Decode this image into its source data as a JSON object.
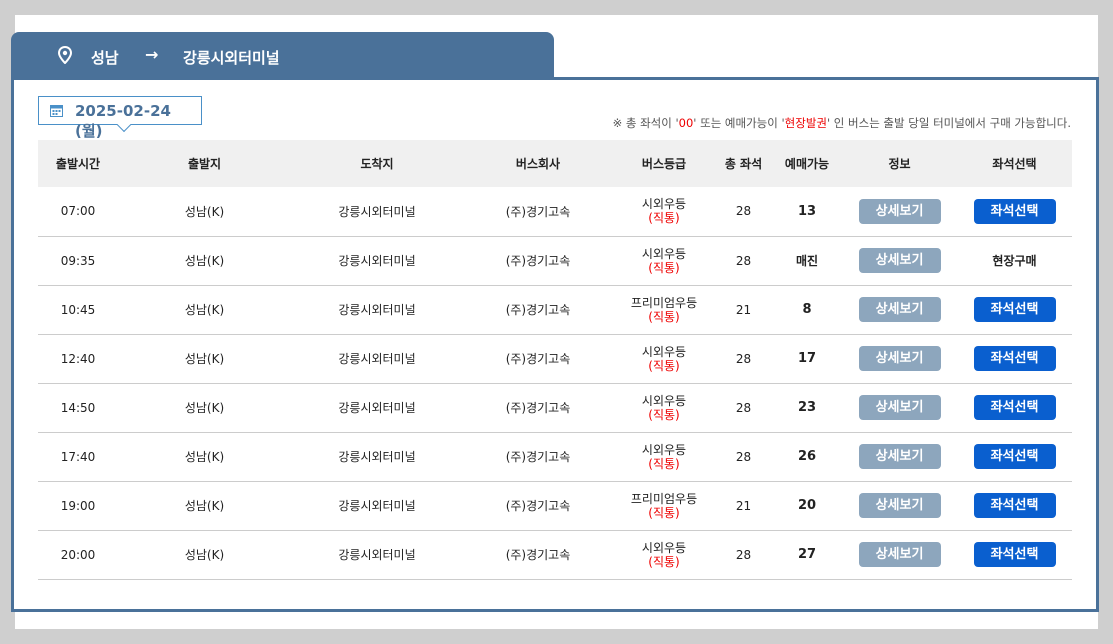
{
  "route": {
    "from": "성남",
    "arrow": "→",
    "to": "강릉시외터미널"
  },
  "date": {
    "value": "2025-02-24 (월)"
  },
  "notice": {
    "prefix": "※ 총 좌석이 '",
    "zero": "00",
    "middle": "' 또는 예매가능이 '",
    "onsite": "현장발권",
    "suffix": "' 인 버스는 출발 당일 터미널에서 구매 가능합니다."
  },
  "table": {
    "headers": [
      "출발시간",
      "출발지",
      "도착지",
      "버스회사",
      "버스등급",
      "총 좌석",
      "예매가능",
      "정보",
      "좌석선택"
    ],
    "rows": [
      {
        "time": "07:00",
        "origin": "성남(K)",
        "destination": "강릉시외터미널",
        "company": "(주)경기고속",
        "grade": "시외우등",
        "grade_sub": "(직통)",
        "total": "28",
        "available": "13",
        "info": "상세보기",
        "select": "좌석선택"
      },
      {
        "time": "09:35",
        "origin": "성남(K)",
        "destination": "강릉시외터미널",
        "company": "(주)경기고속",
        "grade": "시외우등",
        "grade_sub": "(직통)",
        "total": "28",
        "available": "매진",
        "info": "상세보기",
        "select": "현장구매"
      },
      {
        "time": "10:45",
        "origin": "성남(K)",
        "destination": "강릉시외터미널",
        "company": "(주)경기고속",
        "grade": "프리미엄우등",
        "grade_sub": "(직통)",
        "total": "21",
        "available": "8",
        "info": "상세보기",
        "select": "좌석선택"
      },
      {
        "time": "12:40",
        "origin": "성남(K)",
        "destination": "강릉시외터미널",
        "company": "(주)경기고속",
        "grade": "시외우등",
        "grade_sub": "(직통)",
        "total": "28",
        "available": "17",
        "info": "상세보기",
        "select": "좌석선택"
      },
      {
        "time": "14:50",
        "origin": "성남(K)",
        "destination": "강릉시외터미널",
        "company": "(주)경기고속",
        "grade": "시외우등",
        "grade_sub": "(직통)",
        "total": "28",
        "available": "23",
        "info": "상세보기",
        "select": "좌석선택"
      },
      {
        "time": "17:40",
        "origin": "성남(K)",
        "destination": "강릉시외터미널",
        "company": "(주)경기고속",
        "grade": "시외우등",
        "grade_sub": "(직통)",
        "total": "28",
        "available": "26",
        "info": "상세보기",
        "select": "좌석선택"
      },
      {
        "time": "19:00",
        "origin": "성남(K)",
        "destination": "강릉시외터미널",
        "company": "(주)경기고속",
        "grade": "프리미엄우등",
        "grade_sub": "(직통)",
        "total": "21",
        "available": "20",
        "info": "상세보기",
        "select": "좌석선택"
      },
      {
        "time": "20:00",
        "origin": "성남(K)",
        "destination": "강릉시외터미널",
        "company": "(주)경기고속",
        "grade": "시외우등",
        "grade_sub": "(직통)",
        "total": "28",
        "available": "27",
        "info": "상세보기",
        "select": "좌석선택"
      }
    ]
  },
  "colors": {
    "brand": "#4a7199",
    "select_button": "#0a5fcf",
    "detail_button": "#8da6bd",
    "alert": "#e00000"
  }
}
